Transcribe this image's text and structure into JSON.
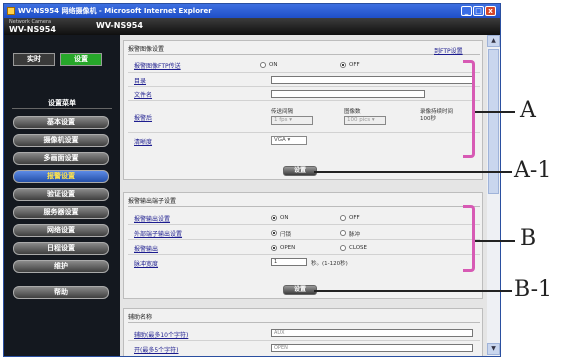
{
  "window": {
    "title": "WV-NS954 网络摄像机 - Microsoft Internet Explorer",
    "min": "_",
    "max": "□",
    "close": "x"
  },
  "header": {
    "network_camera": "Network Camera",
    "model": "WV-NS954",
    "model_right": "WV-NS954"
  },
  "nav": {
    "tab_live": "实时",
    "tab_setup": "设置",
    "menu_title": "设置菜单",
    "items": [
      "基本设置",
      "摄像机设置",
      "多画面设置",
      "报警设置",
      "验证设置",
      "服务器设置",
      "网络设置",
      "日程设置",
      "维护",
      "帮助"
    ],
    "active_index": 3
  },
  "alarm_image": {
    "section_title": "报警图像设置",
    "ftp_link": "到FTP设置",
    "ftp_label": "报警图像FTP传送",
    "ftp_on": "ON",
    "ftp_off": "OFF",
    "ftp_selected": "OFF",
    "dir_label": "目录",
    "filename_label": "文件名",
    "after_label": "报警后",
    "interval_head": "传送间隔",
    "interval_value": "1 fps",
    "count_head": "图像数",
    "count_value": "100 pics",
    "record_head": "录像持续时间",
    "record_value": "100秒",
    "res_label": "清晰度",
    "res_value": "VGA",
    "set_button": "设置"
  },
  "alarm_output": {
    "section_title": "报警输出端子设置",
    "out_label": "报警输出设置",
    "out_on": "ON",
    "out_off": "OFF",
    "out_selected": "ON",
    "ext_label": "外部端子输出设置",
    "ext_a": "闩锁",
    "ext_b": "脉冲",
    "ext_selected": "闩锁",
    "trig_label": "报警输出",
    "trig_a": "OPEN",
    "trig_b": "CLOSE",
    "trig_selected": "OPEN",
    "pulse_label": "脉冲宽度",
    "pulse_value": "1",
    "pulse_unit": "秒。(1-120秒)",
    "set_button": "设置"
  },
  "aux": {
    "section_title": "辅助名称",
    "r1_label": "辅助(最多10个字符)",
    "r1_value": "AUX",
    "r2_label": "开(最多5个字符)",
    "r2_value": "OPEN"
  },
  "callouts": {
    "a": "A",
    "a1": "A-1",
    "b": "B",
    "b1": "B-1"
  },
  "colors": {
    "highlight": "#d75ab4",
    "setup_tab": "#27a72a",
    "title_bar": "#2a5bd6"
  }
}
